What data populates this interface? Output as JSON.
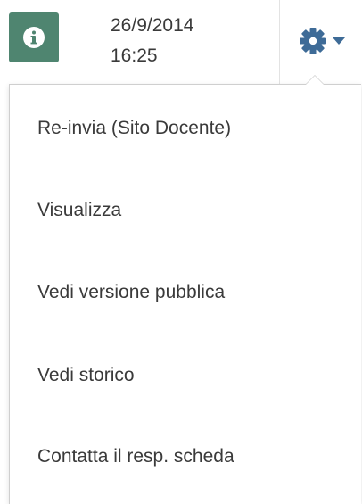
{
  "row": {
    "info_icon": "info-icon",
    "date": "26/9/2014",
    "time": "16:25",
    "settings_icon": "gear-icon",
    "settings_caret_icon": "caret-down-icon"
  },
  "menu": {
    "items": [
      {
        "label": "Re-invia (Sito Docente)"
      },
      {
        "label": "Visualizza"
      },
      {
        "label": "Vedi versione pubblica"
      },
      {
        "label": "Vedi storico"
      },
      {
        "label": "Contatta il resp. scheda"
      }
    ]
  },
  "colors": {
    "info_button": "#4f8570",
    "gear_accent": "#3e6b97",
    "text": "#3a3a3a"
  }
}
